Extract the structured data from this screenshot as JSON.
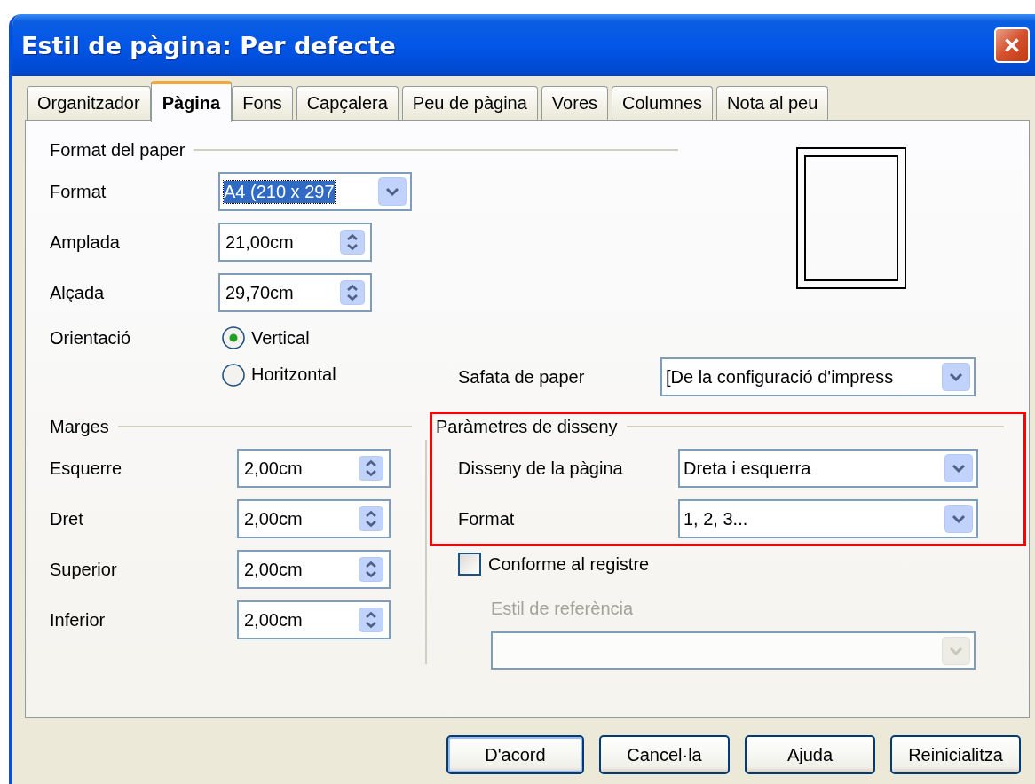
{
  "window": {
    "title": "Estil de pàgina: Per defecte"
  },
  "tabs": [
    {
      "label": "Organitzador",
      "selected": false
    },
    {
      "label": "Pàgina",
      "selected": true
    },
    {
      "label": "Fons",
      "selected": false
    },
    {
      "label": "Capçalera",
      "selected": false
    },
    {
      "label": "Peu de pàgina",
      "selected": false
    },
    {
      "label": "Vores",
      "selected": false
    },
    {
      "label": "Columnes",
      "selected": false
    },
    {
      "label": "Nota al peu",
      "selected": false
    }
  ],
  "paper_format": {
    "legend": "Format del paper",
    "format": {
      "label": "Format",
      "value": "A4 (210 x 297",
      "highlighted": true
    },
    "width": {
      "label": "Amplada",
      "value": "21,00cm"
    },
    "height": {
      "label": "Alçada",
      "value": "29,70cm"
    },
    "orientation": {
      "label": "Orientació",
      "options": [
        {
          "label": "Vertical",
          "selected": true
        },
        {
          "label": "Horitzontal",
          "selected": false
        }
      ]
    },
    "paper_tray": {
      "label": "Safata de paper",
      "value": "[De la configuració d'impress"
    }
  },
  "margins": {
    "legend": "Marges",
    "fields": [
      {
        "label": "Esquerre",
        "value": "2,00cm"
      },
      {
        "label": "Dret",
        "value": "2,00cm"
      },
      {
        "label": "Superior",
        "value": "2,00cm"
      },
      {
        "label": "Inferior",
        "value": "2,00cm"
      }
    ]
  },
  "layout_settings": {
    "legend": "Paràmetres de disseny",
    "highlighted": true,
    "fields": [
      {
        "label": "Disseny de la pàgina",
        "value": "Dreta i esquerra"
      },
      {
        "label": "Format",
        "value": "1, 2, 3..."
      }
    ]
  },
  "register_true": {
    "label": "Conforme al registre",
    "checked": false
  },
  "reference_style": {
    "label": "Estil de referència",
    "disabled": true
  },
  "buttons": [
    {
      "label": "D'acord",
      "default": true
    },
    {
      "label": "Cancel·la",
      "default": false
    },
    {
      "label": "Ajuda",
      "default": false
    },
    {
      "label": "Reinicialitza",
      "default": false
    }
  ]
}
